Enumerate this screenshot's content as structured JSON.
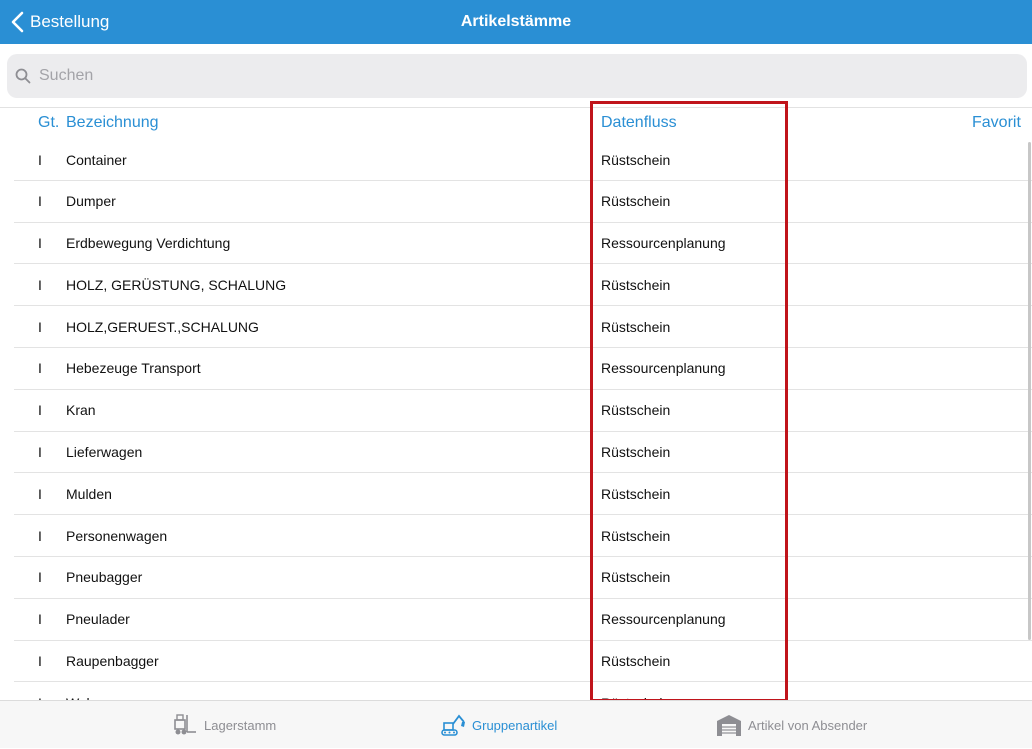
{
  "navbar": {
    "back_label": "Bestellung",
    "title": "Artikelstämme"
  },
  "search": {
    "placeholder": "Suchen"
  },
  "columns": {
    "type": "Gt.",
    "name": "Bezeichnung",
    "flow": "Datenfluss",
    "favorite": "Favorit"
  },
  "rows": [
    {
      "type": "I",
      "name": "Container",
      "flow": "Rüstschein"
    },
    {
      "type": "I",
      "name": "Dumper",
      "flow": "Rüstschein"
    },
    {
      "type": "I",
      "name": "Erdbewegung Verdichtung",
      "flow": "Ressourcenplanung"
    },
    {
      "type": "I",
      "name": "HOLZ, GERÜSTUNG, SCHALUNG",
      "flow": "Rüstschein"
    },
    {
      "type": "I",
      "name": "HOLZ,GERUEST.,SCHALUNG",
      "flow": "Rüstschein"
    },
    {
      "type": "I",
      "name": "Hebezeuge Transport",
      "flow": "Ressourcenplanung"
    },
    {
      "type": "I",
      "name": "Kran",
      "flow": "Rüstschein"
    },
    {
      "type": "I",
      "name": "Lieferwagen",
      "flow": "Rüstschein"
    },
    {
      "type": "I",
      "name": "Mulden",
      "flow": "Rüstschein"
    },
    {
      "type": "I",
      "name": "Personenwagen",
      "flow": "Rüstschein"
    },
    {
      "type": "I",
      "name": "Pneubagger",
      "flow": "Rüstschein"
    },
    {
      "type": "I",
      "name": "Pneulader",
      "flow": "Ressourcenplanung"
    },
    {
      "type": "I",
      "name": "Raupenbagger",
      "flow": "Rüstschein"
    },
    {
      "type": "I",
      "name": "Walzen",
      "flow": "Rüstschein"
    }
  ],
  "tabs": [
    {
      "label": "Lagerstamm",
      "icon": "forklift-icon",
      "active": false
    },
    {
      "label": "Gruppenartikel",
      "icon": "excavator-icon",
      "active": true
    },
    {
      "label": "Artikel von Absender",
      "icon": "warehouse-icon",
      "active": false
    }
  ],
  "colors": {
    "accent": "#2a8fd4",
    "highlight": "#c0141b",
    "inactive": "#8e8e93"
  }
}
